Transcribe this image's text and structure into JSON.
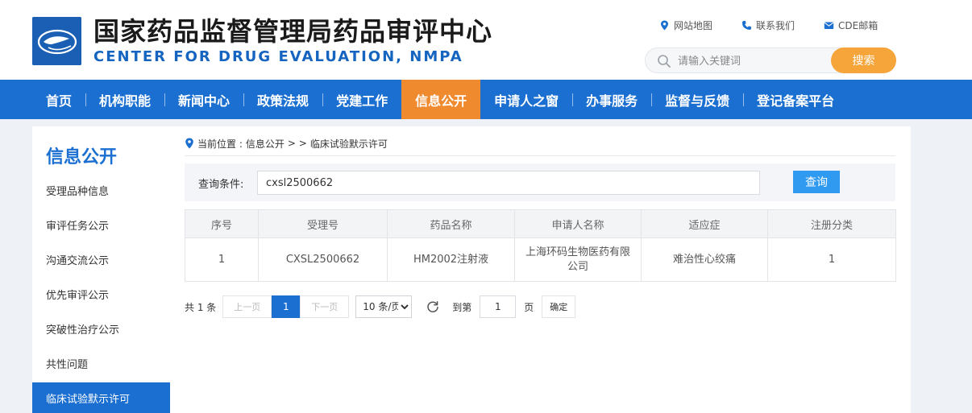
{
  "header": {
    "title_cn": "国家药品监督管理局药品审评中心",
    "title_en": "CENTER FOR DRUG EVALUATION, NMPA",
    "top_links": [
      {
        "label": "网站地图",
        "icon": "map-pin-icon"
      },
      {
        "label": "联系我们",
        "icon": "phone-icon"
      },
      {
        "label": "CDE邮箱",
        "icon": "mail-icon"
      }
    ],
    "search": {
      "placeholder": "请输入关键词",
      "button_label": "搜索"
    }
  },
  "nav": {
    "items": [
      "首页",
      "机构职能",
      "新闻中心",
      "政策法规",
      "党建工作",
      "信息公开",
      "申请人之窗",
      "办事服务",
      "监督与反馈",
      "登记备案平台"
    ],
    "active_index": 5
  },
  "sidebar": {
    "title": "信息公开",
    "items": [
      "受理品种信息",
      "审评任务公示",
      "沟通交流公示",
      "优先审评公示",
      "突破性治疗公示",
      "共性问题",
      "临床试验默示许可"
    ],
    "active_index": 6
  },
  "main": {
    "breadcrumb": {
      "prefix": "当前位置 : ",
      "section": "信息公开",
      "separator": " > > ",
      "page": "临床试验默示许可"
    },
    "query": {
      "label": "查询条件:",
      "value": "cxsl2500662",
      "button_label": "查询"
    },
    "table": {
      "headers": [
        "序号",
        "受理号",
        "药品名称",
        "申请人名称",
        "适应症",
        "注册分类"
      ],
      "rows": [
        [
          "1",
          "CXSL2500662",
          "HM2002注射液",
          "上海环码生物医药有限公司",
          "难治性心绞痛",
          "1"
        ]
      ]
    },
    "pager": {
      "total_text": "共 1 条",
      "prev_label": "上一页",
      "current_page": "1",
      "next_label": "下一页",
      "page_size_label": "10 条/页",
      "goto_label": "到第",
      "goto_value": "1",
      "page_unit": "页",
      "confirm_label": "确定"
    }
  },
  "colors": {
    "brand_blue": "#1a6fd1",
    "nav_active_orange": "#f08a2e",
    "search_button_orange": "#f6a53b",
    "query_button_blue": "#2f9af0"
  }
}
